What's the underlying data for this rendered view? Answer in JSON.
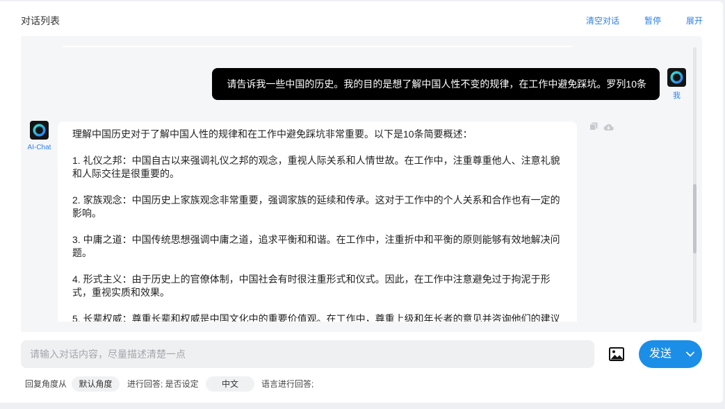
{
  "header": {
    "title": "对话列表",
    "actions": {
      "clear": "清空对话",
      "pause": "暂停",
      "expand": "展开"
    }
  },
  "chat": {
    "user_message": {
      "sender": "我",
      "text": "请告诉我一些中国的历史。我的目的是想了解中国人性不变的规律，在工作中避免踩坑。罗列10条"
    },
    "assistant_message": {
      "sender": "AI-Chat",
      "paragraphs": [
        "理解中国历史对于了解中国人性的规律和在工作中避免踩坑非常重要。以下是10条简要概述：",
        "1. 礼仪之邦：中国自古以来强调礼仪之邦的观念，重视人际关系和人情世故。在工作中，注重尊重他人、注意礼貌和人际交往是很重要的。",
        "2. 家族观念：中国历史上家族观念非常重要，强调家族的延续和传承。这对于工作中的个人关系和合作也有一定的影响。",
        "3. 中庸之道：中国传统思想强调中庸之道，追求平衡和和谐。在工作中，注重折中和平衡的原则能够有效地解决问题。",
        "4. 形式主义：由于历史上的官僚体制，中国社会有时很注重形式和仪式。因此，在工作中注意避免过于拘泥于形式，重视实质和效果。",
        "5. 长辈权威：尊重长辈和权威是中国文化中的重要价值观。在工作中，尊重上级和年长者的意见并咨询他们的建议"
      ]
    }
  },
  "composer": {
    "placeholder": "请输入对话内容，尽量描述清楚一点",
    "send_label": "发送"
  },
  "reply_options": {
    "prefix": "回复角度从",
    "angle": "默认角度",
    "middle": "进行回答; 是否设定",
    "language": "中文",
    "suffix": "语言进行回答;"
  },
  "icons": {
    "avatar": "ai-logo-icon",
    "copy": "copy-icon",
    "download": "cloud-download-icon",
    "upload_image": "image-icon",
    "send_menu": "chevron-down-icon"
  },
  "colors": {
    "accent": "#1b8ee8",
    "link": "#2d7fe6",
    "user_bubble": "#000000",
    "assistant_bubble": "#ffffff",
    "chat_background": "#f5f6f8"
  }
}
